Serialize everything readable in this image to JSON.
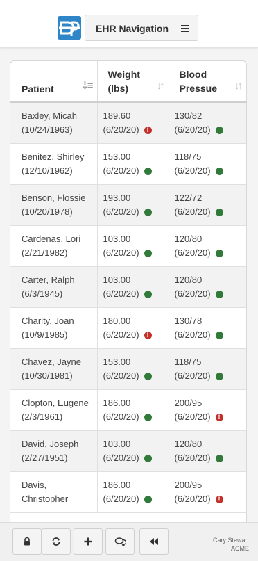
{
  "header": {
    "nav_label": "EHR Navigation"
  },
  "table": {
    "columns": {
      "patient": "Patient",
      "weight": "Weight (lbs)",
      "bp": "Blood Pressue"
    },
    "rows": [
      {
        "name": "Baxley, Micah",
        "dob": "(10/24/1963)",
        "weight": "189.60",
        "weight_date": "(6/20/20)",
        "weight_status": "alert",
        "bp": "130/82",
        "bp_date": "(6/20/20)",
        "bp_status": "ok"
      },
      {
        "name": "Benitez, Shirley",
        "dob": "(12/10/1962)",
        "weight": "153.00",
        "weight_date": "(6/20/20)",
        "weight_status": "ok",
        "bp": "118/75",
        "bp_date": "(6/20/20)",
        "bp_status": "ok"
      },
      {
        "name": "Benson, Flossie",
        "dob": "(10/20/1978)",
        "weight": "193.00",
        "weight_date": "(6/20/20)",
        "weight_status": "ok",
        "bp": "122/72",
        "bp_date": "(6/20/20)",
        "bp_status": "ok"
      },
      {
        "name": "Cardenas, Lori",
        "dob": "(2/21/1982)",
        "weight": "103.00",
        "weight_date": "(6/20/20)",
        "weight_status": "ok",
        "bp": "120/80",
        "bp_date": "(6/20/20)",
        "bp_status": "ok"
      },
      {
        "name": "Carter, Ralph",
        "dob": "(6/3/1945)",
        "weight": "103.00",
        "weight_date": "(6/20/20)",
        "weight_status": "ok",
        "bp": "120/80",
        "bp_date": "(6/20/20)",
        "bp_status": "ok"
      },
      {
        "name": "Charity, Joan",
        "dob": "(10/9/1985)",
        "weight": "180.00",
        "weight_date": "(6/20/20)",
        "weight_status": "alert",
        "bp": "130/78",
        "bp_date": "(6/20/20)",
        "bp_status": "ok"
      },
      {
        "name": "Chavez, Jayne",
        "dob": "(10/30/1981)",
        "weight": "153.00",
        "weight_date": "(6/20/20)",
        "weight_status": "ok",
        "bp": "118/75",
        "bp_date": "(6/20/20)",
        "bp_status": "ok"
      },
      {
        "name": "Clopton, Eugene",
        "dob": "(2/3/1961)",
        "weight": "186.00",
        "weight_date": "(6/20/20)",
        "weight_status": "ok",
        "bp": "200/95",
        "bp_date": "(6/20/20)",
        "bp_status": "alert"
      },
      {
        "name": "David, Joseph",
        "dob": "(2/27/1951)",
        "weight": "103.00",
        "weight_date": "(6/20/20)",
        "weight_status": "ok",
        "bp": "120/80",
        "bp_date": "(6/20/20)",
        "bp_status": "ok"
      },
      {
        "name": "Davis, Christopher",
        "dob": "",
        "weight": "186.00",
        "weight_date": "(6/20/20)",
        "weight_status": "ok",
        "bp": "200/95",
        "bp_date": "(6/20/20)",
        "bp_status": "alert"
      }
    ]
  },
  "status_colors": {
    "ok": "#317a3a",
    "alert": "#c2302a"
  },
  "footer": {
    "buttons": [
      "lock-icon",
      "refresh-icon",
      "plus-icon",
      "chat-icon",
      "rewind-icon"
    ],
    "user_name": "Cary Stewart",
    "org": "ACME"
  }
}
